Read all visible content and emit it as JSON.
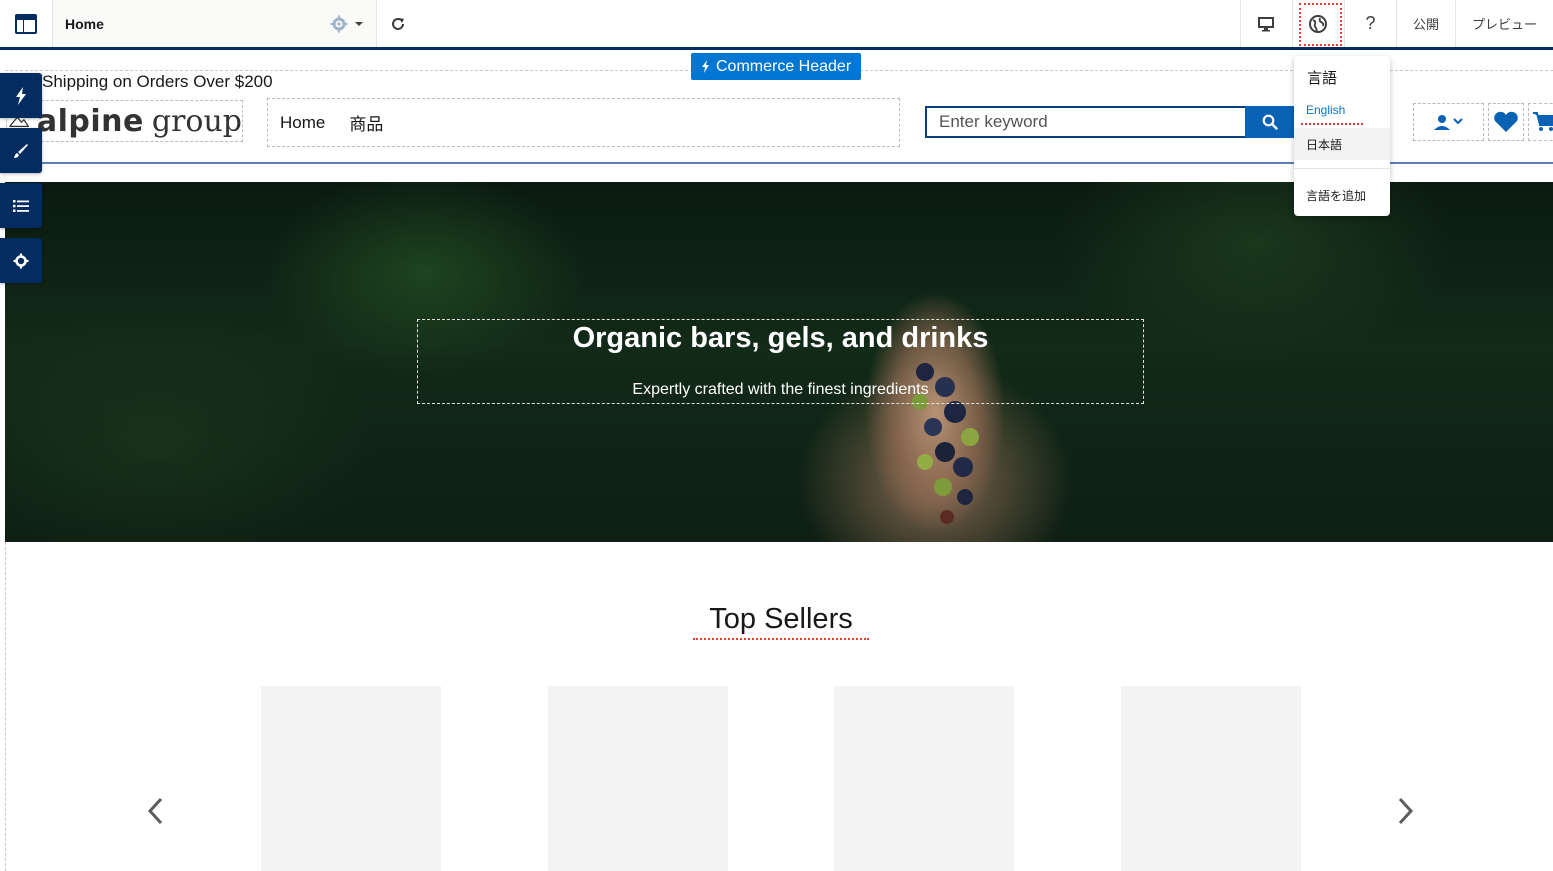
{
  "builder": {
    "page_name": "Home",
    "publish_label": "公開",
    "preview_label": "プレビュー",
    "help_label": "?",
    "colors": {
      "navy": "#032d60",
      "brand_blue": "#0176d3",
      "highlight_red": "#e0403a"
    }
  },
  "commerce_header_badge": "Commerce Header",
  "site": {
    "shipping_banner": "Shipping on Orders Over $200",
    "logo_word1": "alpine",
    "logo_word2": "group",
    "nav": [
      "Home",
      "商品"
    ],
    "search_placeholder": "Enter keyword",
    "icons": [
      "account-icon",
      "wishlist-heart-icon",
      "cart-icon"
    ]
  },
  "hero": {
    "title": "Organic bars, gels, and drinks",
    "subtitle": "Expertly crafted with the finest ingredients"
  },
  "top_sellers": {
    "title": "Top Sellers"
  },
  "language_menu": {
    "title": "言語",
    "items": [
      "English",
      "日本語"
    ],
    "selected": "English",
    "add_language": "言語を追加"
  },
  "tool_rail": [
    "lightning-icon",
    "brush-icon",
    "list-icon",
    "gear-icon"
  ]
}
